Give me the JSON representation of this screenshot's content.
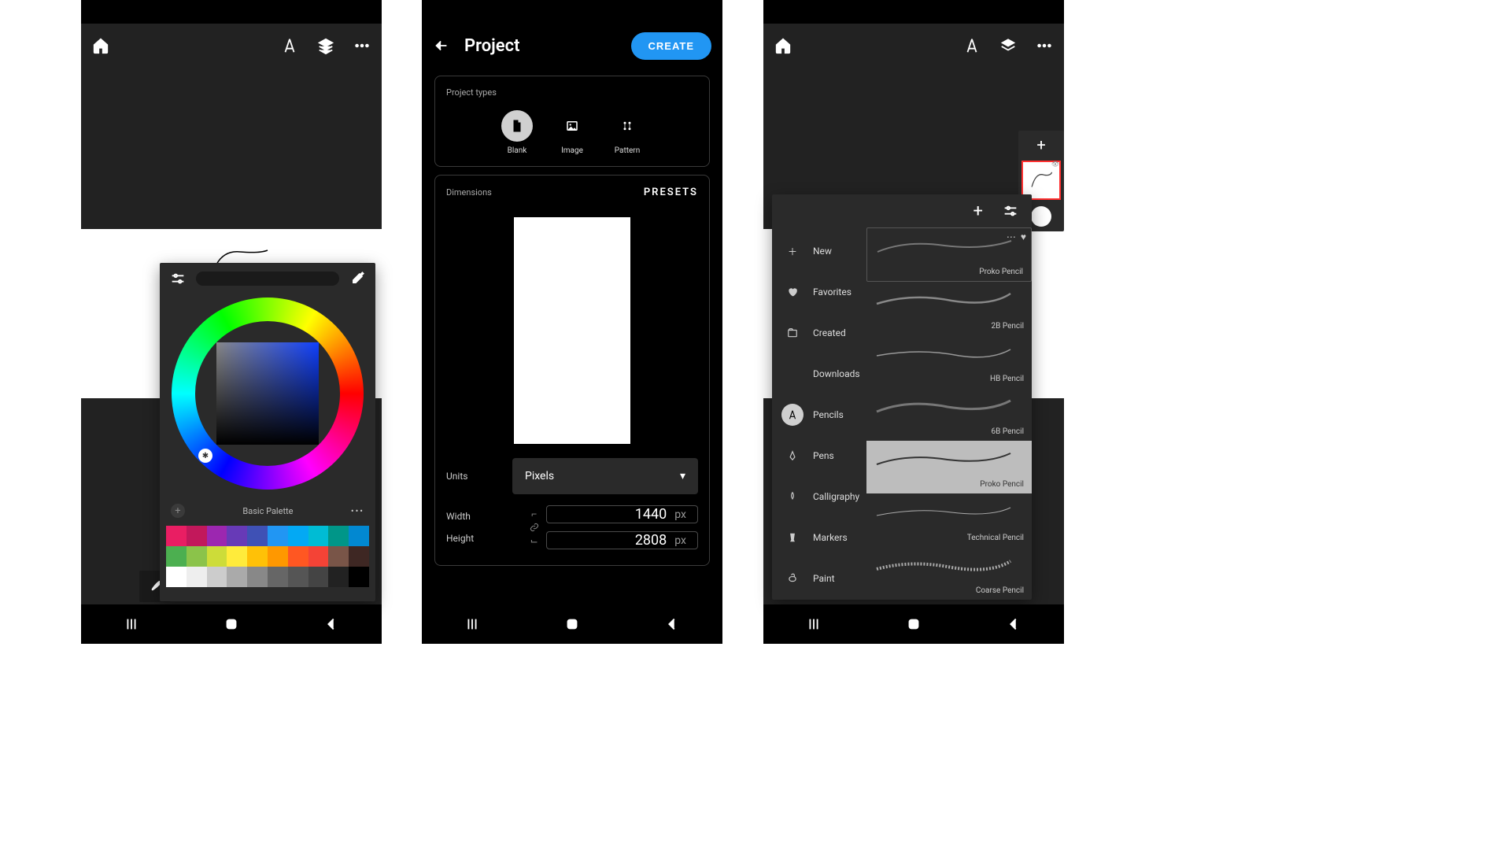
{
  "s1": {
    "palette_name": "Basic Palette",
    "row1": [
      "#e91e63",
      "#c2185b",
      "#9c27b0",
      "#673ab7",
      "#3f51b5",
      "#2196f3",
      "#03a9f4",
      "#00bcd4",
      "#009688",
      "#0288d1"
    ],
    "row2": [
      "#4caf50",
      "#8bc34a",
      "#cddc39",
      "#ffeb3b",
      "#ffc107",
      "#ff9800",
      "#ff5722",
      "#f44336",
      "#795548",
      "#3e2723"
    ],
    "row3": [
      "#ffffff",
      "#eeeeee",
      "#cccccc",
      "#aaaaaa",
      "#888888",
      "#666666",
      "#555555",
      "#444444",
      "#222222",
      "#000000"
    ]
  },
  "s2": {
    "title": "Project",
    "create": "CREATE",
    "types_label": "Project types",
    "types": {
      "blank": "Blank",
      "image": "Image",
      "pattern": "Pattern"
    },
    "dim_label": "Dimensions",
    "presets": "PRESETS",
    "units_label": "Units",
    "units_value": "Pixels",
    "width_label": "Width",
    "width_value": "1440",
    "height_label": "Height",
    "height_value": "2808",
    "px": "px"
  },
  "s3": {
    "cats": {
      "new": "New",
      "fav": "Favorites",
      "created": "Created",
      "dl": "Downloads",
      "pencils": "Pencils",
      "pens": "Pens",
      "calli": "Calligraphy",
      "markers": "Markers",
      "paint": "Paint"
    },
    "brushes": {
      "proko": "Proko Pencil",
      "b2b": "2B Pencil",
      "hb": "HB Pencil",
      "b6b": "6B Pencil",
      "proko2": "Proko Pencil",
      "tech": "Technical Pencil",
      "coarse": "Coarse Pencil"
    }
  }
}
